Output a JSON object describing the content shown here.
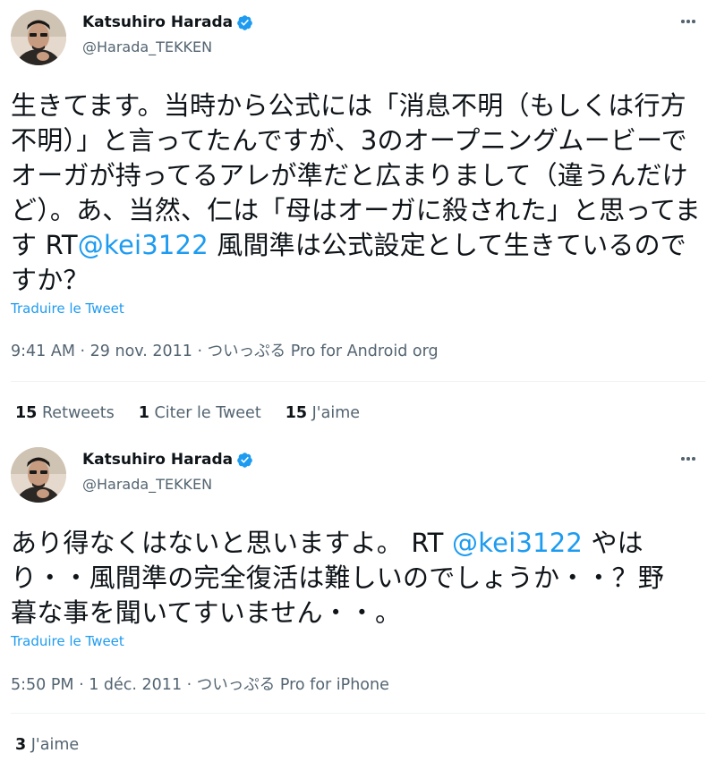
{
  "tweets": [
    {
      "author": {
        "name": "Katsuhiro Harada",
        "handle": "@Harada_TEKKEN",
        "verified": true
      },
      "text": {
        "before_mention": "生きてます。当時から公式には「消息不明（もしくは行方不明）」と言ってたんですが、3のオープニングムービーでオーガが持ってるアレが準だと広まりまして（違うんだけど）。あ、当然、仁は「母はオーガに殺された」と思ってます RT",
        "mention": "@kei3122",
        "after_mention": " 風間準は公式設定として生きているのですか？"
      },
      "translate_label": "Traduire le Tweet",
      "meta": {
        "time": "9:41 AM",
        "sep": " · ",
        "date": "29 nov. 2011",
        "source": "ついっぷる Pro for Android org"
      },
      "stats": [
        {
          "count": "15",
          "label": "Retweets"
        },
        {
          "count": "1",
          "label": "Citer le Tweet"
        },
        {
          "count": "15",
          "label": "J'aime"
        }
      ]
    },
    {
      "author": {
        "name": "Katsuhiro Harada",
        "handle": "@Harada_TEKKEN",
        "verified": true
      },
      "text": {
        "before_mention": "あり得なくはないと思いますよ。 RT ",
        "mention": "@kei3122",
        "after_mention": " やはり・・風間準の完全復活は難しいのでしょうか・・？野暮な事を聞いてすいません・・。"
      },
      "translate_label": "Traduire le Tweet",
      "meta": {
        "time": "5:50 PM",
        "sep": " · ",
        "date": "1 déc. 2011",
        "source": "ついっぷる Pro for iPhone"
      },
      "stats": [
        {
          "count": "3",
          "label": "J'aime"
        }
      ]
    }
  ],
  "icons": {
    "verified": "verified-badge-icon",
    "more": "more-options-icon",
    "avatar": "user-avatar"
  },
  "colors": {
    "link": "#1d9bf0",
    "secondary": "#536471",
    "text": "#0f1419",
    "divider": "#eff3f4",
    "background": "#ffffff"
  }
}
